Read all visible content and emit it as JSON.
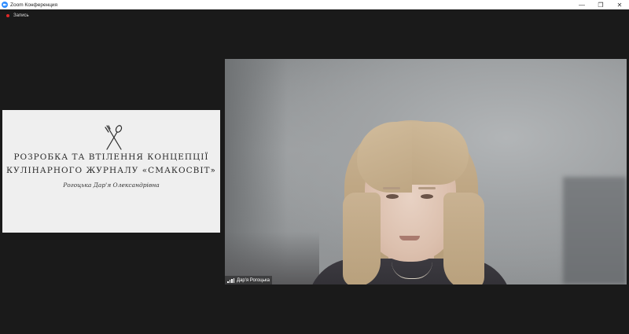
{
  "window": {
    "title": "Zoom Конференция",
    "controls": {
      "minimize": "—",
      "restore": "❐",
      "close": "✕"
    }
  },
  "recording": {
    "label": "Запись",
    "color": "#e02828"
  },
  "slide": {
    "title_line1": "РОЗРОБКА ТА ВТІЛЕННЯ КОНЦЕПЦІЇ",
    "title_line2": "КУЛІНАРНОГО ЖУРНАЛУ «СМАКОСВІТ»",
    "author": "Рогоцька Дар'я Олександрівна",
    "icon": "fork-spoon-icon"
  },
  "participant": {
    "name": "Дар'я Рогоцька"
  },
  "colors": {
    "accent": "#2d8cff",
    "background": "#1a1a1a"
  }
}
